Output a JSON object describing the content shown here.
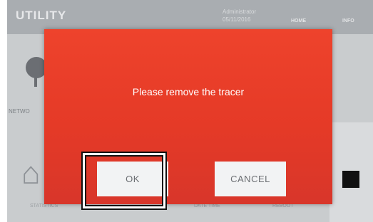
{
  "header": {
    "title": "UTILITY",
    "user": "Administrator",
    "date": "05/11/2016",
    "home_label": "HOME",
    "info_label": "INFO"
  },
  "background": {
    "network_label": "NETWO",
    "statistics_label": "STATISTICS",
    "datetime_label": "DATE TIME",
    "reboot_label": "REBOOT"
  },
  "dialog": {
    "message": "Please remove the tracer",
    "ok_label": "OK",
    "cancel_label": "CANCEL",
    "background_color": "#e8402b"
  },
  "icons": {
    "network": "network-icon",
    "home": "home-icon"
  }
}
